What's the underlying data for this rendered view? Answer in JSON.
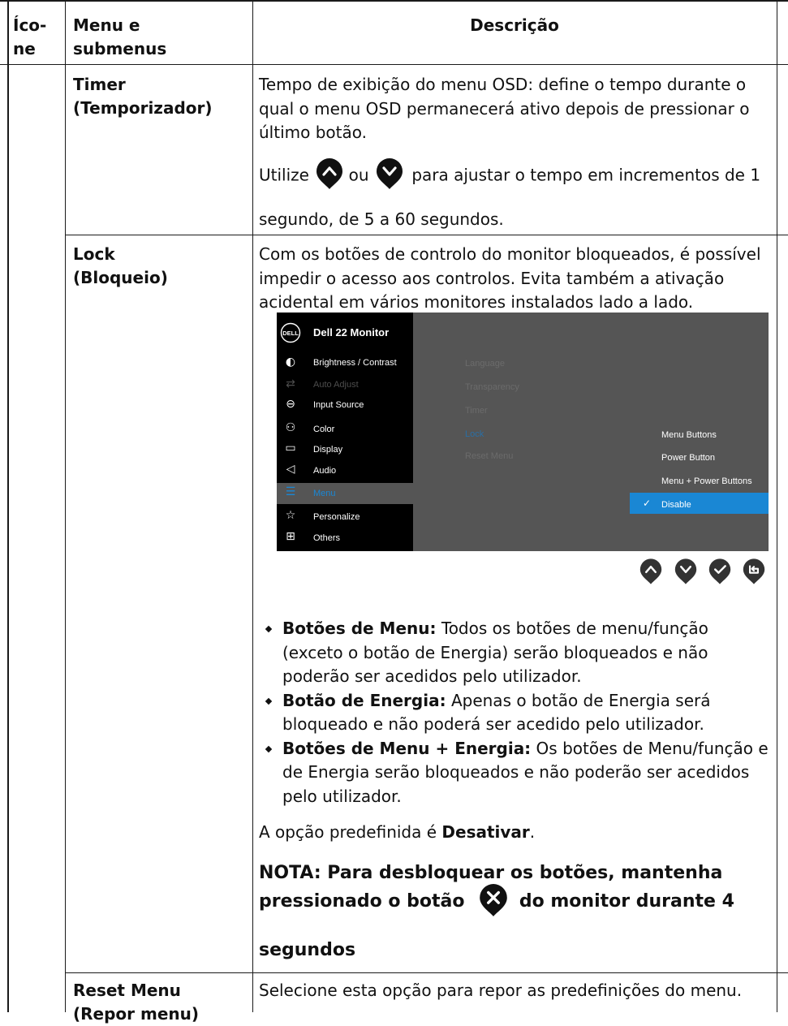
{
  "header": {
    "col1": "Íco-\nne",
    "col2": "Menu e\nsubmenus",
    "col3": "Descrição"
  },
  "rows": {
    "timer": {
      "menu": "Timer\n(Temporizador)",
      "desc": "Tempo de exibição do menu OSD: define o tempo durante o qual o menu OSD permanecerá ativo depois de pressionar o último botão.",
      "utilize": "Utilize",
      "ou": "ou",
      "adjust": "para ajustar o tempo em incrementos de 1",
      "range": "segundo, de 5 a 60 segundos."
    },
    "lock": {
      "menu": "Lock\n(Bloqueio)",
      "desc": "Com os botões de controlo do monitor bloqueados, é possível impedir o acesso aos controlos. Evita também a ativação acidental em vários monitores instalados lado a lado.",
      "bullets": [
        {
          "bold": "Botões de Menu:",
          "text": " Todos os botões de menu/função (exceto o botão de Energia) serão bloqueados e não poderão ser acedidos pelo utilizador."
        },
        {
          "bold": "Botão de Energia:",
          "text": " Apenas o botão de Energia será bloqueado e não poderá ser acedido pelo utilizador."
        },
        {
          "bold": "Botões de Menu + Energia:",
          "text": " Os botões de Menu/função e de Energia serão bloqueados e não poderão ser acedidos pelo utilizador."
        }
      ],
      "default_prefix": "A opção predefinida é ",
      "default_value": "Desativar",
      "default_suffix": ".",
      "note_line1": "NOTA: Para desbloquear os botões, mantenha",
      "note_pre": "pressionado o botão",
      "note_post": "do monitor durante 4",
      "note_end": "segundos"
    },
    "reset": {
      "menu": "Reset Menu\n(Repor menu)",
      "desc": "Selecione esta opção para repor as predefinições do menu."
    }
  },
  "osd": {
    "logo": "DELL",
    "title": "Dell 22 Monitor",
    "menu_items": [
      {
        "icon": "brightness-icon",
        "label": "Brightness / Contrast",
        "state": "normal"
      },
      {
        "icon": "auto-adjust-icon",
        "label": "Auto Adjust",
        "state": "dim"
      },
      {
        "icon": "input-source-icon",
        "label": "Input Source",
        "state": "normal"
      },
      {
        "icon": "color-icon",
        "label": "Color",
        "state": "normal"
      },
      {
        "icon": "display-icon",
        "label": "Display",
        "state": "normal"
      },
      {
        "icon": "audio-icon",
        "label": "Audio",
        "state": "normal"
      },
      {
        "icon": "menu-icon",
        "label": "Menu",
        "state": "selected"
      },
      {
        "icon": "star-icon",
        "label": "Personalize",
        "state": "normal"
      },
      {
        "icon": "others-icon",
        "label": "Others",
        "state": "normal"
      }
    ],
    "submenu_items": [
      "Language",
      "Transparency",
      "Timer",
      "Lock",
      "Reset Menu"
    ],
    "options": [
      "Menu Buttons",
      "Power Button",
      "Menu + Power Buttons",
      "Disable"
    ],
    "selected_option": "Disable",
    "accent": "#1a87d4"
  },
  "nav_buttons": [
    "up-icon",
    "down-icon",
    "check-icon",
    "back-icon"
  ]
}
